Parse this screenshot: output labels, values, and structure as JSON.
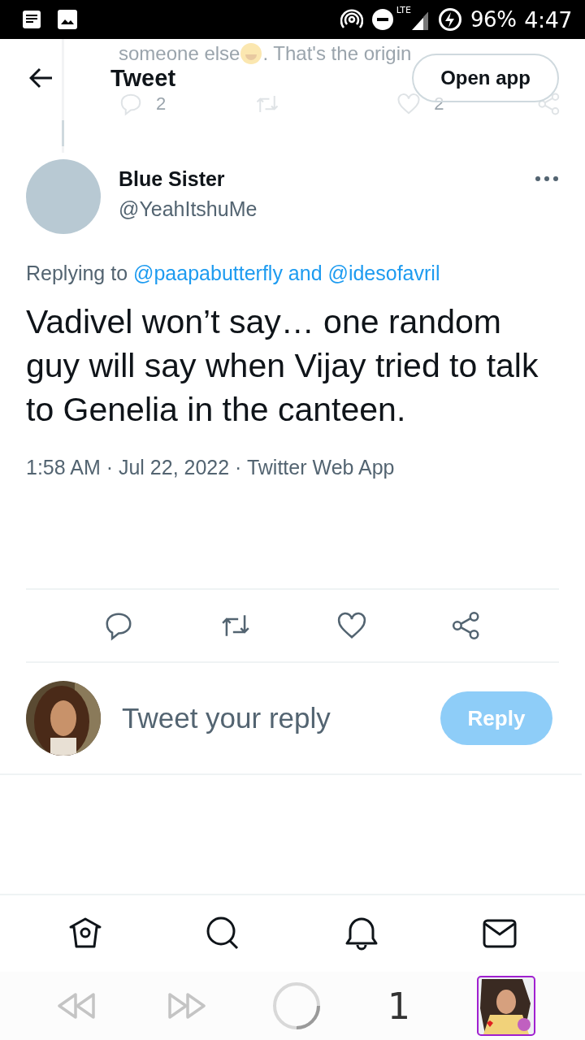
{
  "status_bar": {
    "network": "LTE",
    "battery": "96%",
    "time": "4:47"
  },
  "previous_tweet": {
    "text_before": "someone else",
    "text_after": ". That's the origin",
    "reply_count": "2",
    "like_count": "2"
  },
  "header": {
    "title": "Tweet",
    "open_app": "Open app"
  },
  "tweet": {
    "name": "Blue Sister",
    "handle": "@YeahItshuMe",
    "replying_label": "Replying to",
    "replying_to": "@paapabutterfly and @idesofavril",
    "text": "Vadivel won’t say… one random guy will say when Vijay tried to talk to Genelia in the canteen.",
    "meta": "1:58 AM · Jul 22, 2022 · Twitter Web App"
  },
  "reply_box": {
    "placeholder": "Tweet your reply",
    "button": "Reply",
    "disabled": true
  },
  "browser_bar": {
    "tab_count": "1"
  }
}
